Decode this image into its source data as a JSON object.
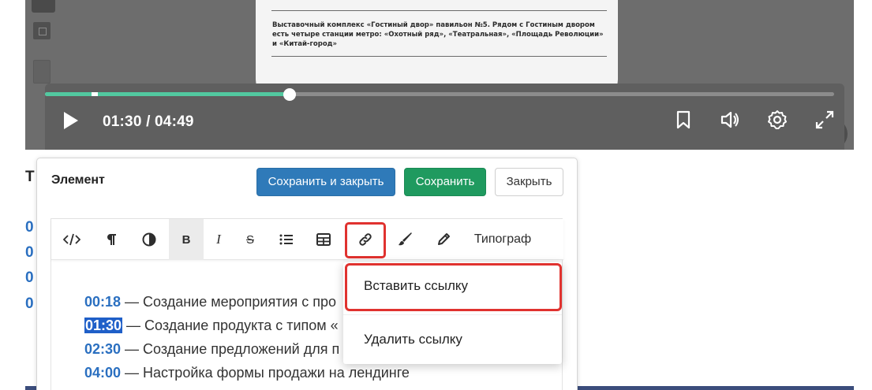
{
  "player": {
    "doc_text": "Выставочный комплекс «Гостиный двор» павильон №5. Рядом с Гостиным двором есть четыре станции метро: «Охотный ряд», «Театральная», «Площадь Революции» и «Китай-город»",
    "current_time": "01:30",
    "duration": "04:49",
    "time_display": "01:30 / 04:49",
    "progress": 0.31,
    "buffered": 0.06,
    "marker_position": 0.059,
    "controls": {
      "play": "play-icon",
      "bookmark": "bookmark-icon",
      "volume": "volume-icon",
      "settings": "gear-icon",
      "fullscreen": "fullscreen-icon"
    },
    "accent_color": "#52c9a0"
  },
  "background": {
    "heading_fragment": "Т",
    "link_fragments": [
      "0",
      "0",
      "0",
      "0"
    ]
  },
  "modal": {
    "title": "Элемент",
    "buttons": {
      "save_close": "Сохранить и закрыть",
      "save": "Сохранить",
      "close": "Закрыть"
    },
    "toolbar": [
      {
        "name": "code",
        "icon": "code-icon"
      },
      {
        "name": "paragraph",
        "icon": "paragraph-icon"
      },
      {
        "name": "contrast",
        "icon": "contrast-icon"
      },
      {
        "name": "bold",
        "icon": "bold-icon",
        "label": "B"
      },
      {
        "name": "italic",
        "icon": "italic-icon",
        "label": "I"
      },
      {
        "name": "strike",
        "icon": "strikethrough-icon",
        "label": "S"
      },
      {
        "name": "list",
        "icon": "list-icon"
      },
      {
        "name": "table",
        "icon": "table-icon"
      },
      {
        "name": "link",
        "icon": "link-icon"
      },
      {
        "name": "brush",
        "icon": "brush-icon"
      },
      {
        "name": "pencil",
        "icon": "pencil-icon"
      }
    ],
    "typograph_label": "Типограф",
    "content": [
      {
        "time": "00:18",
        "text": " — Создание мероприятия с про"
      },
      {
        "time": "01:30",
        "text": " — Создание продукта с типом «"
      },
      {
        "time": "02:30",
        "text": " — Создание предложений для п"
      },
      {
        "time": "04:00",
        "text": " — Настройка формы продажи на лендинге"
      }
    ],
    "selected_time": "01:30"
  },
  "dropdown": {
    "insert_link": "Вставить ссылку",
    "remove_link": "Удалить ссылку"
  },
  "colors": {
    "primary": "#2f7ab9",
    "success": "#1f9a5f",
    "highlight": "#e0322f",
    "link": "#2a6fc0"
  }
}
